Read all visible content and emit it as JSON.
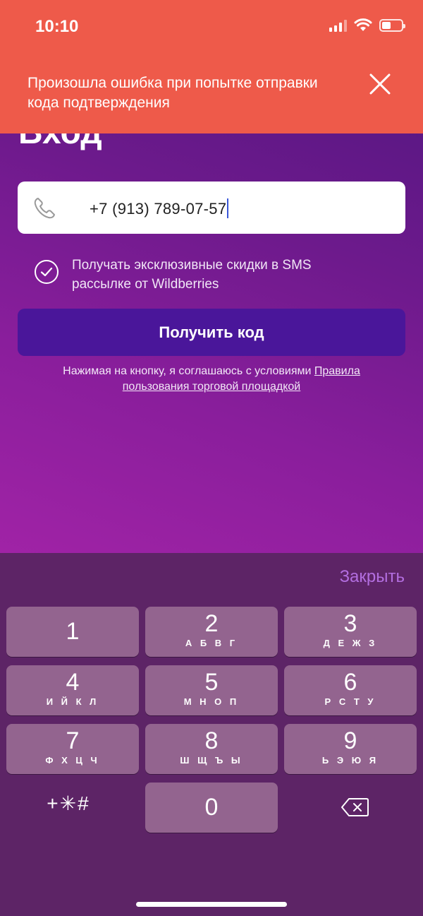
{
  "status_bar": {
    "time": "10:10"
  },
  "error_banner": {
    "message": "Произошла ошибка при попытке отправки кода подтверждения"
  },
  "page": {
    "title": "Вход"
  },
  "phone_field": {
    "value": "+7 (913) 789-07-57"
  },
  "consent": {
    "label": "Получать эксклюзивные скидки в SMS рассылке от Wildberries",
    "checked": true
  },
  "get_code_button": {
    "label": "Получить код"
  },
  "terms": {
    "text": "Нажимая на кнопку, я соглашаюсь с условиями ",
    "link": "Правила пользования торговой площадкой"
  },
  "keyboard": {
    "close_label": "Закрыть",
    "keys": [
      {
        "digit": "1",
        "letters": ""
      },
      {
        "digit": "2",
        "letters": "А Б В Г"
      },
      {
        "digit": "3",
        "letters": "Д Е Ж З"
      },
      {
        "digit": "4",
        "letters": "И Й К Л"
      },
      {
        "digit": "5",
        "letters": "М Н О П"
      },
      {
        "digit": "6",
        "letters": "Р С Т У"
      },
      {
        "digit": "7",
        "letters": "Ф Х Ц Ч"
      },
      {
        "digit": "8",
        "letters": "Ш Щ Ъ Ы"
      },
      {
        "digit": "9",
        "letters": "Ь Э Ю Я"
      },
      {
        "digit": "0",
        "letters": ""
      }
    ],
    "symbols_label": "+✳#"
  },
  "colors": {
    "error": "#ee5a4a",
    "primary_button": "#4a169a",
    "background": "#6d1a8c",
    "keyboard": "#5d2466",
    "key": "#93648f",
    "accent": "#b36ee0"
  },
  "icons": [
    "close-icon",
    "phone-icon",
    "checkmark-circle-icon",
    "delete-backspace-icon",
    "wifi-icon",
    "battery-icon",
    "cellular-signal-icon"
  ]
}
